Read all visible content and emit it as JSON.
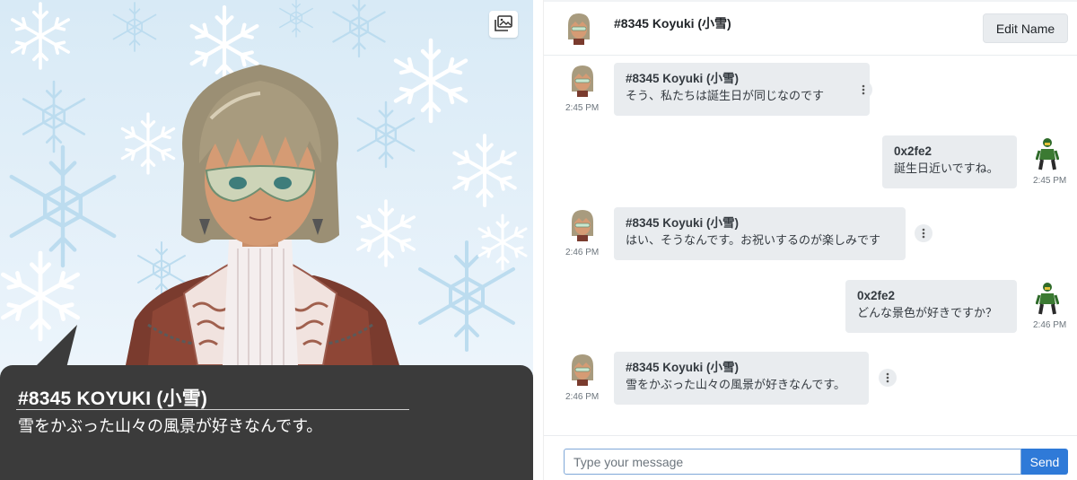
{
  "character_panel": {
    "speaker_name": "#8345 KOYUKI (小雪)",
    "speech_text": "雪をかぶった山々の風景が好きなんです。",
    "background_icon": "image-icon"
  },
  "chat": {
    "header": {
      "name": "#8345 Koyuki (小雪)",
      "edit_button": "Edit Name"
    },
    "messages": [
      {
        "sender": "#8345 Koyuki (小雪)",
        "text": "そう、私たちは誕生日が同じなのです",
        "time": "2:45 PM",
        "side": "left"
      },
      {
        "sender": "0x2fe2",
        "text": "誕生日近いですね。",
        "time": "2:45 PM",
        "side": "right"
      },
      {
        "sender": "#8345 Koyuki (小雪)",
        "text": "はい、そうなんです。お祝いするのが楽しみです",
        "time": "2:46 PM",
        "side": "left"
      },
      {
        "sender": "0x2fe2",
        "text": "どんな景色が好きですか？",
        "time": "2:46 PM",
        "side": "right"
      },
      {
        "sender": "#8345 Koyuki (小雪)",
        "text": "雪をかぶった山々の風景が好きなんです。",
        "time": "2:46 PM",
        "side": "left"
      }
    ],
    "composer": {
      "placeholder": "Type your message",
      "send_label": "Send"
    }
  },
  "colors": {
    "bubble": "#e9ecef",
    "send_button": "#2f7ad8",
    "speech_box": "#3b3b3b"
  }
}
